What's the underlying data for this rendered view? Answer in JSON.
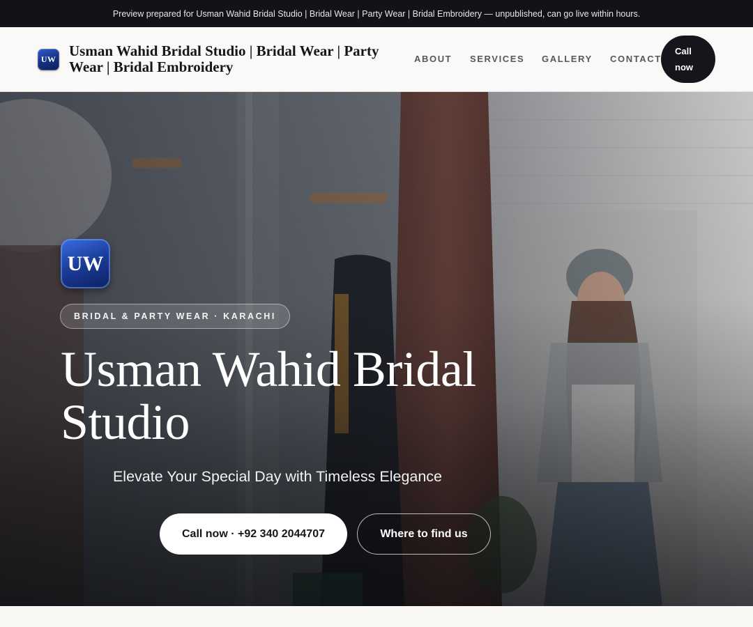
{
  "banner": {
    "text": "Preview prepared for Usman Wahid Bridal Studio | Bridal Wear | Party Wear | Bridal Embroidery — unpublished, can go live within hours."
  },
  "header": {
    "logo_initials": "UW",
    "site_title": "Usman Wahid Bridal Studio | Bridal Wear | Party Wear | Bridal Embroidery",
    "nav": [
      {
        "label": "ABOUT"
      },
      {
        "label": "SERVICES"
      },
      {
        "label": "GALLERY"
      },
      {
        "label": "CONTACT"
      }
    ],
    "call_label": "Call now"
  },
  "hero": {
    "logo_initials": "UW",
    "pill_text": "BRIDAL & PARTY WEAR · KARACHI",
    "title": "Usman Wahid Bridal Studio",
    "tagline": "Elevate Your Special Day with Timeless Elegance",
    "primary_cta": "Call now · +92 340 2044707",
    "secondary_cta": "Where to find us"
  },
  "colors": {
    "banner_bg": "#111319",
    "header_bg": "#faf9f7",
    "accent_dark": "#15151b",
    "logo_blue": "#1a3b98"
  },
  "icons": {
    "logo": "uw-monogram-badge"
  }
}
